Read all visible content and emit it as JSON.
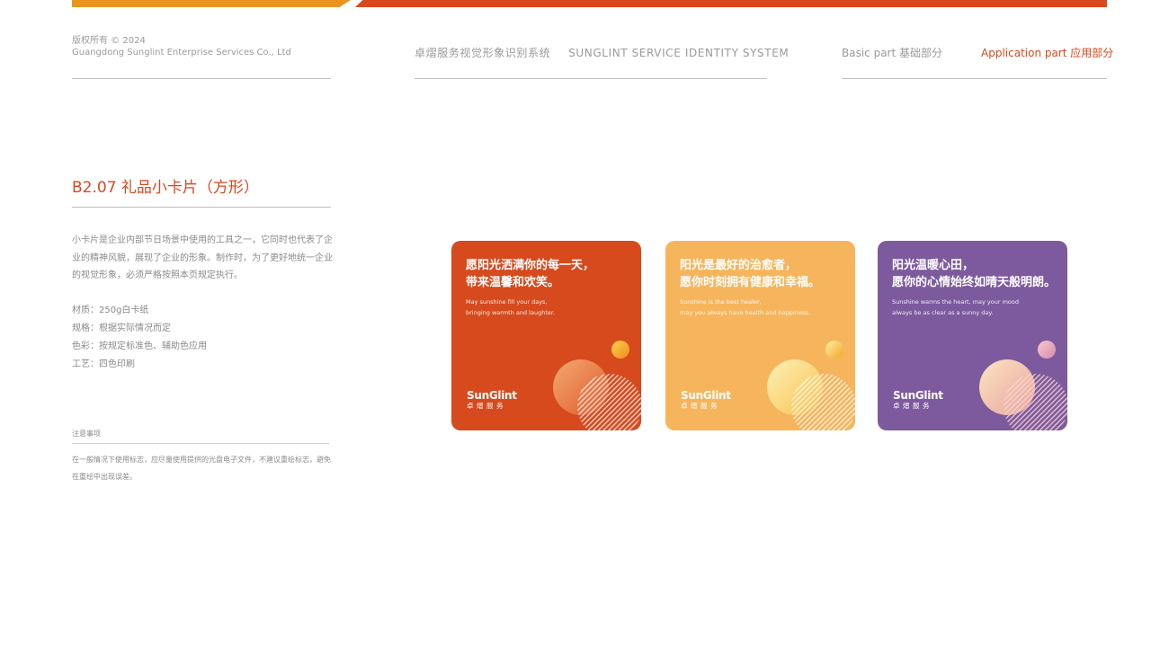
{
  "header": {
    "copyright_line1": "版权所有 © 2024",
    "copyright_line2": "Guangdong Sunglint Enterprise Services Co., Ltd",
    "system_title_cn": "卓熠服务视觉形象识别系统",
    "system_title_en": "SUNGLINT SERVICE IDENTITY SYSTEM",
    "nav_basic": "Basic part 基础部分",
    "nav_application": "Application part 应用部分"
  },
  "colors": {
    "brand_orange": "#d9481e",
    "accent_amber": "#e8941e",
    "card_orange": "#d64a1e",
    "card_yellow": "#f6b55c",
    "card_purple": "#7d5a9e"
  },
  "section": {
    "title": "B2.07 礼品小卡片（方形）",
    "description": "小卡片是企业内部节日场景中使用的工具之一，它同时也代表了企业的精神风貌，展现了企业的形象。制作时，为了更好地统一企业的视觉形象，必须严格按照本页规定执行。",
    "specs": [
      "材质：250g白卡纸",
      "规格：根据实际情况而定",
      "色彩：按规定标准色、辅助色应用",
      "工艺：四色印刷"
    ],
    "notes_label": "注意事项",
    "notes_text": "在一般情况下使用标志，应尽量使用提供的光盘电子文件，不建议重绘标志，避免在重绘中出现误差。"
  },
  "cards": [
    {
      "headline_1": "愿阳光洒满你的每一天，",
      "headline_2": "带来温馨和欢笑。",
      "sub_1": "May sunshine fill your days,",
      "sub_2": "bringing warmth and laughter.",
      "logo_word": "SunGlint",
      "logo_cn": "卓熠服务"
    },
    {
      "headline_1": "阳光是最好的治愈者，",
      "headline_2": "愿你时刻拥有健康和幸福。",
      "sub_1": "Sunshine is the best healer,",
      "sub_2": "may you always have health and happiness.",
      "logo_word": "SunGlint",
      "logo_cn": "卓熠服务"
    },
    {
      "headline_1": "阳光温暖心田，",
      "headline_2": "愿你的心情始终如晴天般明朗。",
      "sub_1": "Sunshine warms the heart, may your mood",
      "sub_2": "always be as clear as a sunny day.",
      "logo_word": "SunGlint",
      "logo_cn": "卓熠服务"
    }
  ]
}
